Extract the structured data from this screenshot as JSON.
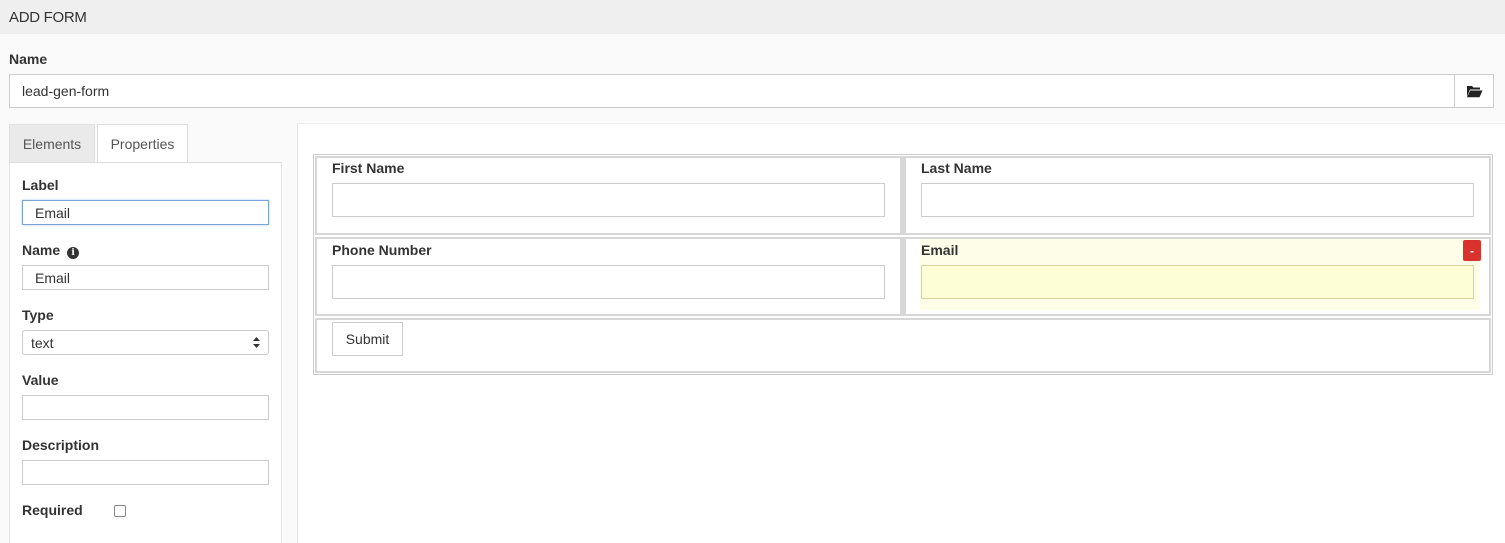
{
  "header": {
    "title": "ADD FORM"
  },
  "form_name": {
    "label": "Name",
    "value": "lead-gen-form",
    "browse_icon": "folder-open-icon"
  },
  "tabs": [
    {
      "label": "Elements",
      "active": false
    },
    {
      "label": "Properties",
      "active": true
    }
  ],
  "properties": {
    "label": {
      "label": "Label",
      "value": "Email"
    },
    "name": {
      "label": "Name",
      "value": "Email",
      "info_icon": "info-circle-icon"
    },
    "type": {
      "label": "Type",
      "value": "text"
    },
    "value": {
      "label": "Value",
      "value": ""
    },
    "description": {
      "label": "Description",
      "value": ""
    },
    "required": {
      "label": "Required",
      "checked": false
    }
  },
  "preview": {
    "fields": [
      {
        "label": "First Name",
        "value": ""
      },
      {
        "label": "Last Name",
        "value": ""
      },
      {
        "label": "Phone Number",
        "value": ""
      },
      {
        "label": "Email",
        "value": "",
        "selected": true
      }
    ],
    "remove_label": "-",
    "submit_label": "Submit"
  },
  "colors": {
    "selected_highlight": "#fefed6",
    "remove_button": "#d9312b"
  }
}
